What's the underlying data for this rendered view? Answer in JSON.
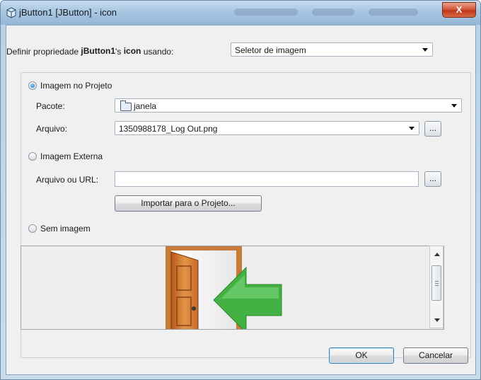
{
  "window": {
    "title": "jButton1 [JButton] - icon",
    "close_label": "X"
  },
  "property_row": {
    "prefix": "Definir propriedade ",
    "component": "jButton1",
    "mid": "'s ",
    "property": "icon",
    "suffix": " usando:",
    "editor_value": "Seletor de imagem"
  },
  "project_image": {
    "label": "Imagem no Projeto",
    "selected": true,
    "package_label": "Pacote:",
    "package_value": "janela",
    "file_label": "Arquivo:",
    "file_value": "1350988178_Log Out.png",
    "browse_label": "..."
  },
  "external_image": {
    "label": "Imagem Externa",
    "selected": false,
    "file_url_label": "Arquivo ou URL:",
    "file_url_value": "",
    "browse_label": "...",
    "import_label": "Importar para o Projeto..."
  },
  "no_image": {
    "label": "Sem imagem",
    "selected": false
  },
  "preview": {
    "image_icon": "log-out-door-arrow-icon"
  },
  "buttons": {
    "ok": "OK",
    "cancel": "Cancelar"
  },
  "colors": {
    "title_bar": "#a7c6e2",
    "close_button": "#c0361a",
    "arrow_green": "#3aa83a",
    "door_orange": "#d2691e"
  }
}
